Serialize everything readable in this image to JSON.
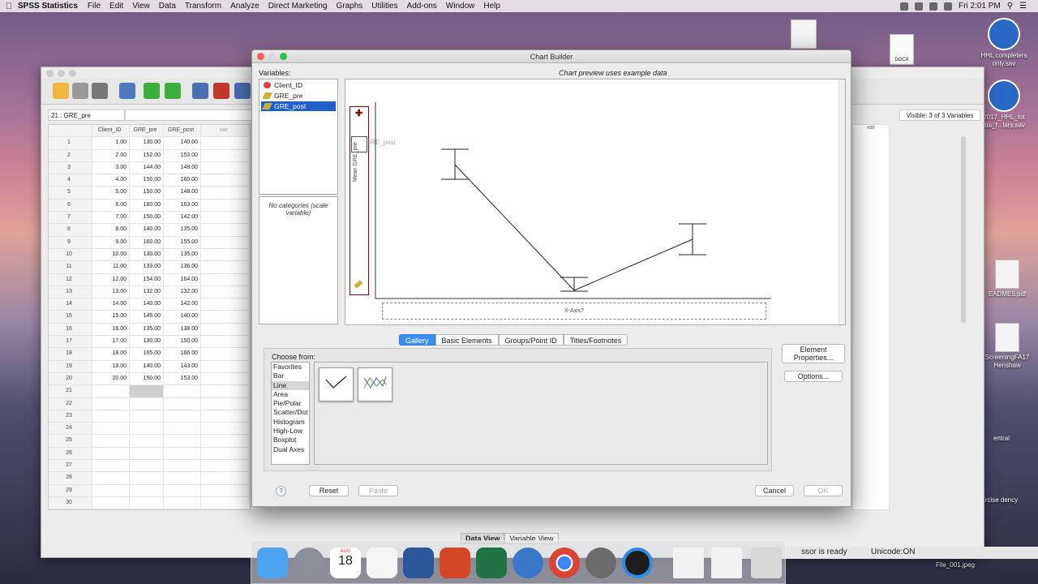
{
  "menubar": {
    "app": "SPSS Statistics",
    "items": [
      "File",
      "Edit",
      "View",
      "Data",
      "Transform",
      "Analyze",
      "Direct Marketing",
      "Graphs",
      "Utilities",
      "Add-ons",
      "Window",
      "Help"
    ],
    "clock": "Fri 2:01 PM"
  },
  "desktop": {
    "icons": [
      {
        "label": "HHL completers only.sav"
      },
      {
        "label": "2017_HHL_tot ata_f...lars.sav"
      },
      {
        "label": "EADME5.pdf"
      },
      {
        "label": "ScreeningFA17 Henshaw"
      },
      {
        "label": "entral"
      },
      {
        "label": "rcise dency"
      },
      {
        "label": "File_001.jpeg"
      }
    ],
    "docx": "DOCX"
  },
  "editor": {
    "cell_ref": "21 : GRE_pre",
    "visible": "Visible: 3 of 3 Variables",
    "columns": [
      "Client_ID",
      "GRE_pre",
      "GRE_post",
      "var"
    ],
    "rows": [
      [
        "1.00",
        "130.00",
        "140.00"
      ],
      [
        "2.00",
        "152.00",
        "153.00"
      ],
      [
        "3.00",
        "144.00",
        "148.00"
      ],
      [
        "4.00",
        "150.00",
        "160.00"
      ],
      [
        "5.00",
        "150.00",
        "148.00"
      ],
      [
        "6.00",
        "160.00",
        "163.00"
      ],
      [
        "7.00",
        "150.00",
        "142.00"
      ],
      [
        "8.00",
        "140.00",
        "135.00"
      ],
      [
        "9.00",
        "160.00",
        "155.00"
      ],
      [
        "10.00",
        "130.00",
        "135.00"
      ],
      [
        "11.00",
        "133.00",
        "136.00"
      ],
      [
        "12.00",
        "154.00",
        "164.00"
      ],
      [
        "13.00",
        "132.00",
        "132.00"
      ],
      [
        "14.00",
        "140.00",
        "142.00"
      ],
      [
        "15.00",
        "145.00",
        "140.00"
      ],
      [
        "16.00",
        "135.00",
        "138.00"
      ],
      [
        "17.00",
        "130.00",
        "150.00"
      ],
      [
        "18.00",
        "165.00",
        "166.00"
      ],
      [
        "19.00",
        "140.00",
        "143.00"
      ],
      [
        "20.00",
        "150.00",
        "153.00"
      ],
      [
        "",
        "",
        ""
      ],
      [
        "",
        "",
        ""
      ],
      [
        "",
        "",
        ""
      ],
      [
        "",
        "",
        ""
      ],
      [
        "",
        "",
        ""
      ],
      [
        "",
        "",
        ""
      ],
      [
        "",
        "",
        ""
      ],
      [
        "",
        "",
        ""
      ],
      [
        "",
        "",
        ""
      ],
      [
        "",
        "",
        ""
      ]
    ],
    "var_label": "var",
    "data_view": "Data View",
    "variable_view": "Variable View",
    "status": "ssor is ready",
    "unicode": "Unicode:ON"
  },
  "dialog": {
    "title": "Chart Builder",
    "variables_label": "Variables:",
    "preview_note": "Chart preview uses example data",
    "variables": [
      "Client_ID",
      "GRE_pre",
      "GRE_post"
    ],
    "no_categories": "No categories (scale variable)",
    "y_label": "Mean GRE_pre",
    "drag_label": "GRE_post",
    "x_axis": "X-Axis?",
    "tabs": [
      "Gallery",
      "Basic Elements",
      "Groups/Point ID",
      "Titles/Footnotes"
    ],
    "choose_from": "Choose from:",
    "chart_types": [
      "Favorites",
      "Bar",
      "Line",
      "Area",
      "Pie/Polar",
      "Scatter/Dot",
      "Histogram",
      "High-Low",
      "Boxplot",
      "Dual Axes"
    ],
    "element_properties": "Element Properties...",
    "options": "Options...",
    "reset": "Reset",
    "paste": "Paste",
    "cancel": "Cancel",
    "ok": "OK",
    "help": "?"
  },
  "dock": {
    "calendar_month": "AUG",
    "calendar_day": "18"
  }
}
